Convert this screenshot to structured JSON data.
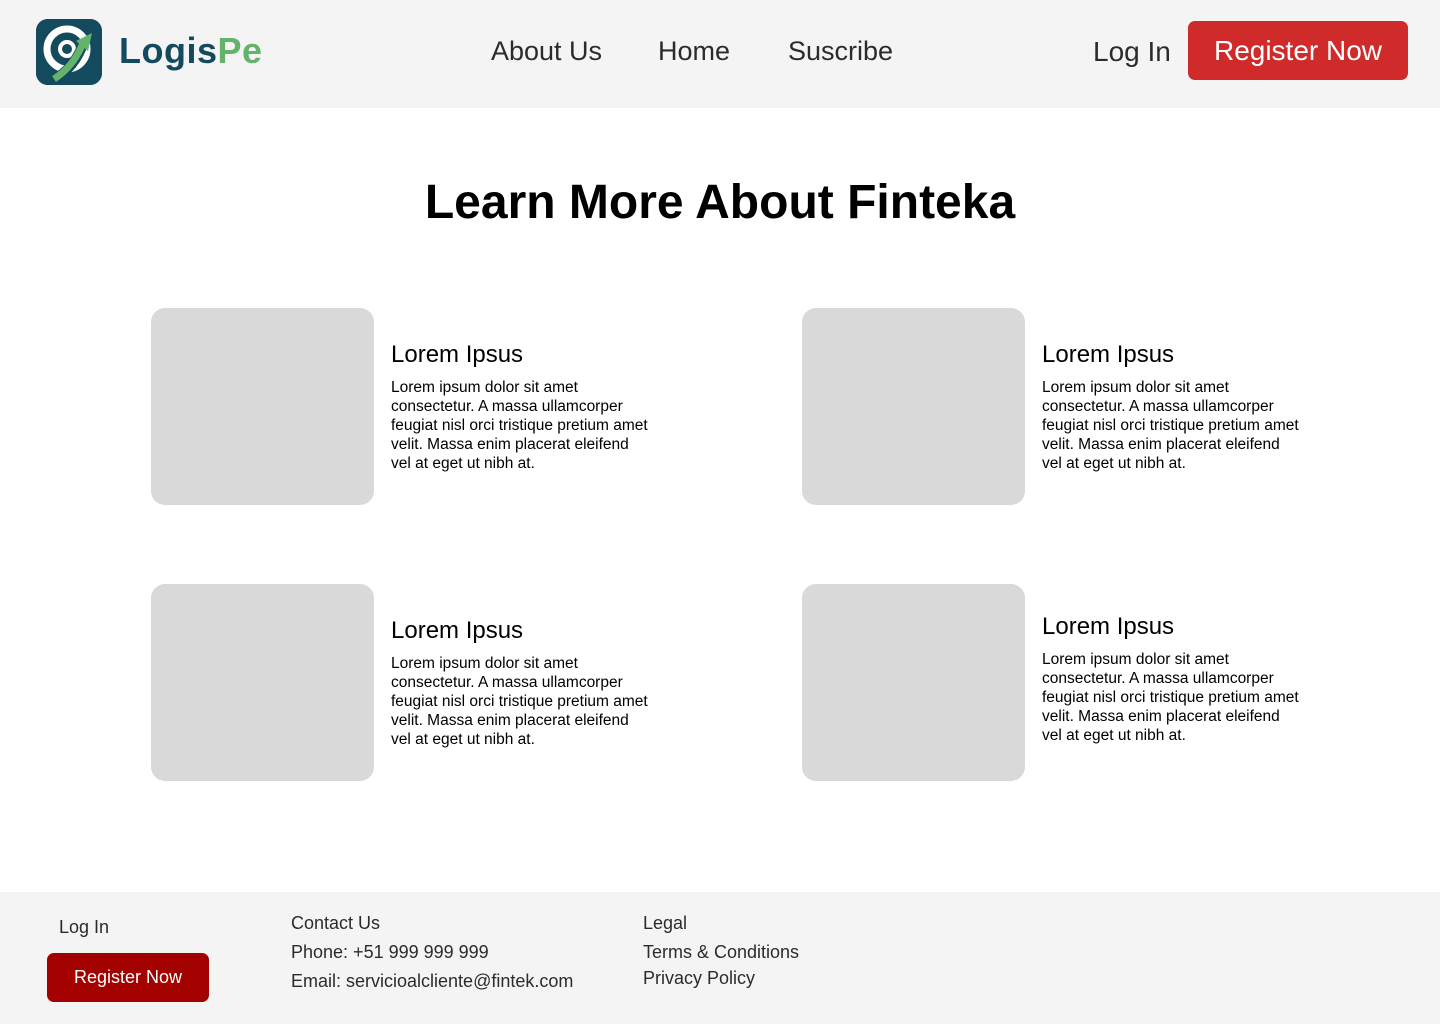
{
  "header": {
    "logo": {
      "part1": "Logis",
      "part2": "Pe",
      "icon": "logispe-logo-icon"
    },
    "nav": [
      {
        "label": "About Us"
      },
      {
        "label": "Home"
      },
      {
        "label": "Suscribe"
      }
    ],
    "login_label": "Log In",
    "register_label": "Register Now"
  },
  "main": {
    "title": "Learn More About Finteka",
    "cards": [
      {
        "title": "Lorem Ipsus",
        "body": "Lorem ipsum dolor sit amet consectetur. A massa ullamcorper feugiat nisl orci tristique pretium amet velit. Massa enim placerat eleifend vel at eget ut nibh at."
      },
      {
        "title": "Lorem Ipsus",
        "body": "Lorem ipsum dolor sit amet consectetur. A massa ullamcorper feugiat nisl orci tristique pretium amet velit. Massa enim placerat eleifend vel at eget ut nibh at."
      },
      {
        "title": "Lorem Ipsus",
        "body": "Lorem ipsum dolor sit amet consectetur. A massa ullamcorper feugiat nisl orci tristique pretium amet velit. Massa enim placerat eleifend vel at eget ut nibh at."
      },
      {
        "title": "Lorem Ipsus",
        "body": "Lorem ipsum dolor sit amet consectetur. A massa ullamcorper feugiat nisl orci tristique pretium amet velit. Massa enim placerat eleifend vel at eget ut nibh at."
      }
    ]
  },
  "footer": {
    "login_label": "Log In",
    "register_label": "Register Now",
    "contact": {
      "heading": "Contact Us",
      "phone": "Phone: +51 999 999 999",
      "email": "Email: servicioalcliente@fintek.com"
    },
    "legal": {
      "heading": "Legal",
      "terms": "Terms & Conditions",
      "privacy": "Privacy Policy"
    }
  },
  "colors": {
    "brand_dark": "#134a5e",
    "brand_green": "#63b36a",
    "register_red": "#cf2b2b",
    "footer_register_red": "#a30000",
    "band_gray": "#f4f4f4",
    "placeholder_gray": "#d9d9d9"
  }
}
